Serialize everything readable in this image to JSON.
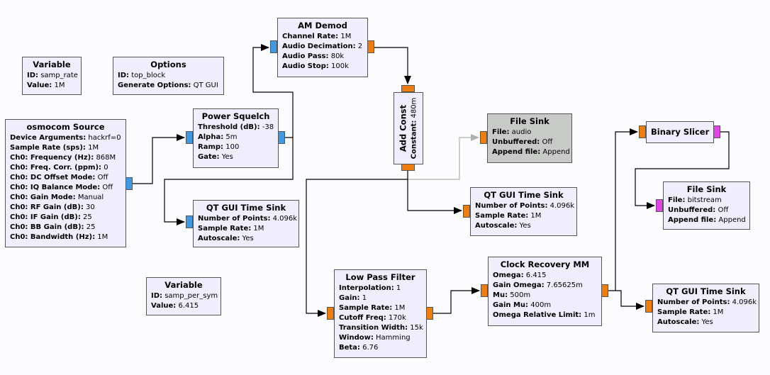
{
  "port_colors": {
    "complex": "#3f9ae6",
    "float": "#f07c0c",
    "byte": "#e244e8",
    "disabled_block": "#c8cac8",
    "block": "#f0eefc"
  },
  "blocks": [
    {
      "id": "variable-samp-rate",
      "title": "Variable",
      "params": [
        {
          "k": "ID:",
          "v": "samp_rate"
        },
        {
          "k": "Value:",
          "v": "1M"
        }
      ]
    },
    {
      "id": "options",
      "title": "Options",
      "params": [
        {
          "k": "ID:",
          "v": "top_block"
        },
        {
          "k": "Generate Options:",
          "v": "QT GUI"
        }
      ]
    },
    {
      "id": "osmocom-source",
      "title": "osmocom Source",
      "params": [
        {
          "k": "Device Arguments:",
          "v": "hackrf=0"
        },
        {
          "k": "Sample Rate (sps):",
          "v": "1M"
        },
        {
          "k": "Ch0: Frequency (Hz):",
          "v": "868M"
        },
        {
          "k": "Ch0: Freq. Corr. (ppm):",
          "v": "0"
        },
        {
          "k": "Ch0: DC Offset Mode:",
          "v": "Off"
        },
        {
          "k": "Ch0: IQ Balance Mode:",
          "v": "Off"
        },
        {
          "k": "Ch0: Gain Mode:",
          "v": "Manual"
        },
        {
          "k": "Ch0: RF Gain (dB):",
          "v": "30"
        },
        {
          "k": "Ch0: IF Gain (dB):",
          "v": "25"
        },
        {
          "k": "Ch0: BB Gain (dB):",
          "v": "25"
        },
        {
          "k": "Ch0: Bandwidth (Hz):",
          "v": "1M"
        }
      ]
    },
    {
      "id": "power-squelch",
      "title": "Power Squelch",
      "params": [
        {
          "k": "Threshold (dB):",
          "v": "-38"
        },
        {
          "k": "Alpha:",
          "v": "5m"
        },
        {
          "k": "Ramp:",
          "v": "100"
        },
        {
          "k": "Gate:",
          "v": "Yes"
        }
      ]
    },
    {
      "id": "qt-gui-time-sink-1",
      "title": "QT GUI Time Sink",
      "params": [
        {
          "k": "Number of Points:",
          "v": "4.096k"
        },
        {
          "k": "Sample Rate:",
          "v": "1M"
        },
        {
          "k": "Autoscale:",
          "v": "Yes"
        }
      ]
    },
    {
      "id": "am-demod",
      "title": "AM Demod",
      "params": [
        {
          "k": "Channel Rate:",
          "v": "1M"
        },
        {
          "k": "Audio Decimation:",
          "v": "2"
        },
        {
          "k": "Audio Pass:",
          "v": "80k"
        },
        {
          "k": "Audio Stop:",
          "v": "100k"
        }
      ]
    },
    {
      "id": "add-const",
      "title": "Add Const",
      "params": [
        {
          "k": "Constant:",
          "v": "480m"
        }
      ]
    },
    {
      "id": "file-sink-audio",
      "title": "File Sink",
      "disabled": true,
      "params": [
        {
          "k": "File:",
          "v": "audio"
        },
        {
          "k": "Unbuffered:",
          "v": "Off"
        },
        {
          "k": "Append file:",
          "v": "Append"
        }
      ]
    },
    {
      "id": "qt-gui-time-sink-2",
      "title": "QT GUI Time Sink",
      "params": [
        {
          "k": "Number of Points:",
          "v": "4.096k"
        },
        {
          "k": "Sample Rate:",
          "v": "1M"
        },
        {
          "k": "Autoscale:",
          "v": "Yes"
        }
      ]
    },
    {
      "id": "low-pass-filter",
      "title": "Low Pass Filter",
      "params": [
        {
          "k": "Interpolation:",
          "v": "1"
        },
        {
          "k": "Gain:",
          "v": "1"
        },
        {
          "k": "Sample Rate:",
          "v": "1M"
        },
        {
          "k": "Cutoff Freq:",
          "v": "170k"
        },
        {
          "k": "Transition Width:",
          "v": "15k"
        },
        {
          "k": "Window:",
          "v": "Hamming"
        },
        {
          "k": "Beta:",
          "v": "6.76"
        }
      ]
    },
    {
      "id": "clock-recovery-mm",
      "title": "Clock Recovery MM",
      "params": [
        {
          "k": "Omega:",
          "v": "6.415"
        },
        {
          "k": "Gain Omega:",
          "v": "7.65625m"
        },
        {
          "k": "Mu:",
          "v": "500m"
        },
        {
          "k": "Gain Mu:",
          "v": "400m"
        },
        {
          "k": "Omega Relative Limit:",
          "v": "1m"
        }
      ]
    },
    {
      "id": "qt-gui-time-sink-3",
      "title": "QT GUI Time Sink",
      "params": [
        {
          "k": "Number of Points:",
          "v": "4.096k"
        },
        {
          "k": "Sample Rate:",
          "v": "1M"
        },
        {
          "k": "Autoscale:",
          "v": "Yes"
        }
      ]
    },
    {
      "id": "binary-slicer",
      "title": "Binary Slicer",
      "params": []
    },
    {
      "id": "file-sink-bitstream",
      "title": "File Sink",
      "params": [
        {
          "k": "File:",
          "v": "bitstream"
        },
        {
          "k": "Unbuffered:",
          "v": "Off"
        },
        {
          "k": "Append file:",
          "v": "Append"
        }
      ]
    },
    {
      "id": "variable-samp-per-sym",
      "title": "Variable",
      "params": [
        {
          "k": "ID:",
          "v": "samp_per_sym"
        },
        {
          "k": "Value:",
          "v": "6.415"
        }
      ]
    }
  ],
  "connections": [
    {
      "from": "osmocom-source",
      "to": "power-squelch"
    },
    {
      "from": "power-squelch",
      "to": "am-demod"
    },
    {
      "from": "power-squelch",
      "to": "qt-gui-time-sink-1"
    },
    {
      "from": "am-demod",
      "to": "add-const"
    },
    {
      "from": "add-const",
      "to": "file-sink-audio",
      "disabled": true
    },
    {
      "from": "add-const",
      "to": "qt-gui-time-sink-2"
    },
    {
      "from": "add-const",
      "to": "low-pass-filter"
    },
    {
      "from": "low-pass-filter",
      "to": "clock-recovery-mm"
    },
    {
      "from": "clock-recovery-mm",
      "to": "binary-slicer"
    },
    {
      "from": "clock-recovery-mm",
      "to": "qt-gui-time-sink-3"
    },
    {
      "from": "binary-slicer",
      "to": "file-sink-bitstream"
    }
  ]
}
